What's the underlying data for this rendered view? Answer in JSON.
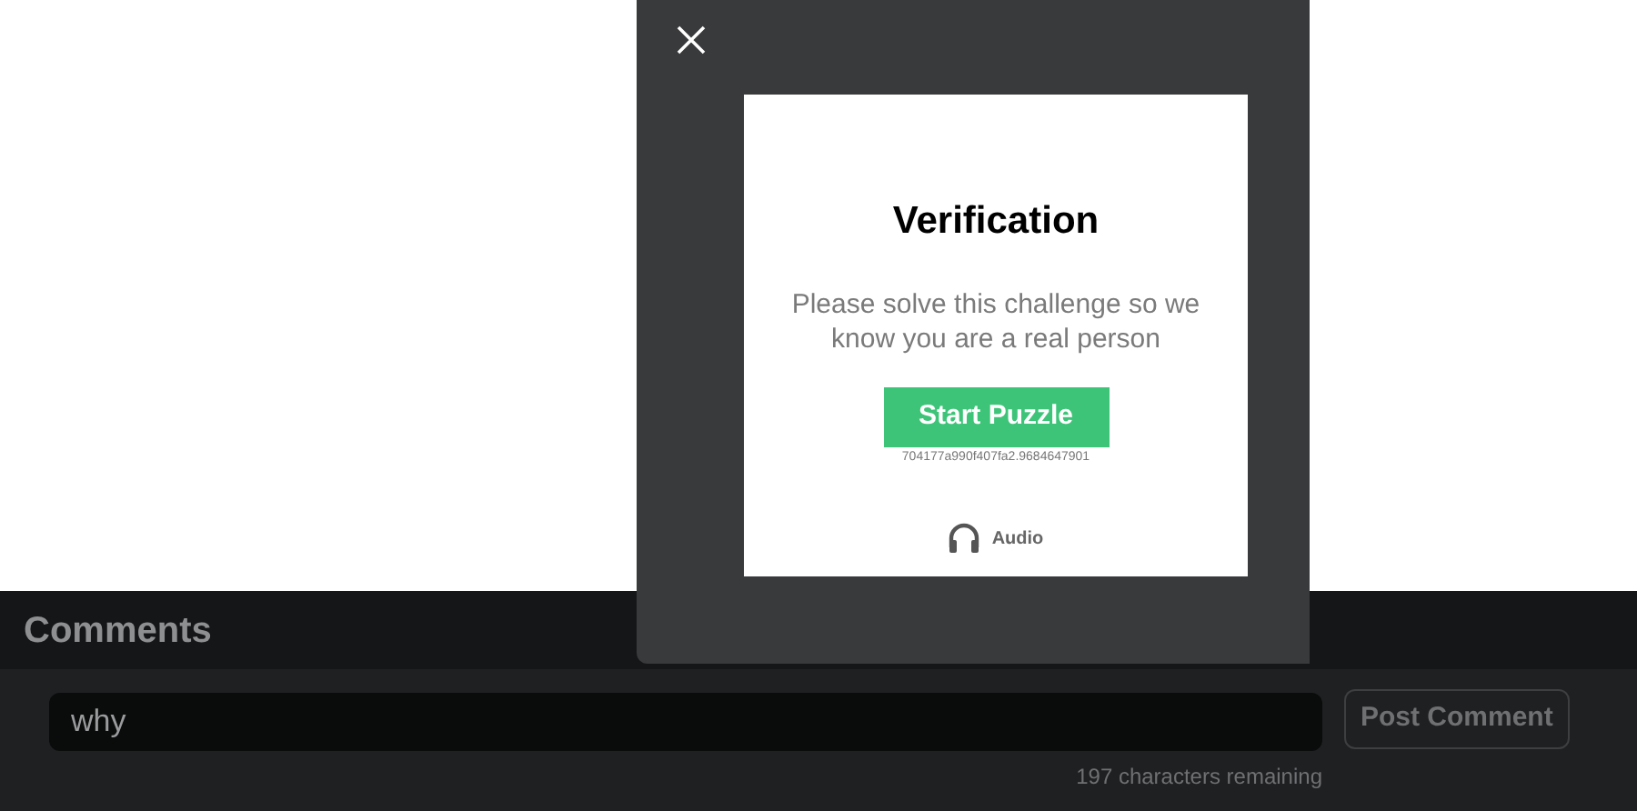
{
  "comments": {
    "title": "Comments",
    "input": {
      "value": "why"
    },
    "post_button": "Post Comment",
    "counter": "197 characters remaining"
  },
  "verification": {
    "title": "Verification",
    "message": "Please solve this challenge so we know you are a real person",
    "start_button": "Start Puzzle",
    "token": "704177a990f407fa2.9684647901",
    "audio_link": "Audio"
  }
}
